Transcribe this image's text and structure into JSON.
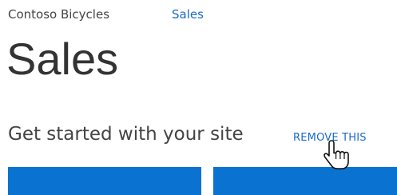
{
  "breadcrumb": {
    "site_name": "Contoso Bicycles",
    "current_link": "Sales"
  },
  "page": {
    "title": "Sales"
  },
  "get_started": {
    "heading": "Get started with your site",
    "remove_label": "REMOVE THIS"
  },
  "colors": {
    "accent": "#1b6ac9",
    "tile": "#0a72d1",
    "text": "#444444"
  },
  "icons": {
    "cursor": "hand-pointer-icon"
  }
}
